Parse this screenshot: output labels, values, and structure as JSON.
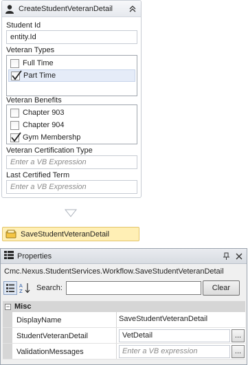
{
  "activity": {
    "title": "CreateStudentVeteranDetail",
    "student_id": {
      "label": "Student Id",
      "value": "entity.Id"
    },
    "veteran_types": {
      "label": "Veteran Types",
      "items": [
        {
          "label": "Full Time",
          "checked": false,
          "selected": false
        },
        {
          "label": "Part Time",
          "checked": true,
          "selected": true
        }
      ]
    },
    "veteran_benefits": {
      "label": "Veteran Benefits",
      "items": [
        {
          "label": "Chapter 903",
          "checked": false
        },
        {
          "label": "Chapter 904",
          "checked": false
        },
        {
          "label": "Gym Membershp",
          "checked": true
        }
      ]
    },
    "certification_type": {
      "label": "Veteran Certification Type",
      "placeholder": "Enter a VB Expression"
    },
    "last_certified_term": {
      "label": "Last Certified Term",
      "placeholder": "Enter a VB Expression"
    }
  },
  "next_activity": {
    "title": "SaveStudentVeteranDetail"
  },
  "properties": {
    "title": "Properties",
    "type_name": "Cmc.Nexus.StudentServices.Workflow.SaveStudentVeteranDetail",
    "search_label": "Search:",
    "search_value": "",
    "clear_label": "Clear",
    "category": "Misc",
    "rows": [
      {
        "name": "DisplayName",
        "value": "SaveStudentVeteranDetail",
        "placeholder": ""
      },
      {
        "name": "StudentVeteranDetail",
        "value": "VetDetail",
        "placeholder": ""
      },
      {
        "name": "ValidationMessages",
        "value": "",
        "placeholder": "Enter a VB expression"
      }
    ],
    "ellipsis_label": "..."
  },
  "colors": {
    "accent_yellow": "#ffefb5",
    "header_gray": "#d6d6d6"
  }
}
